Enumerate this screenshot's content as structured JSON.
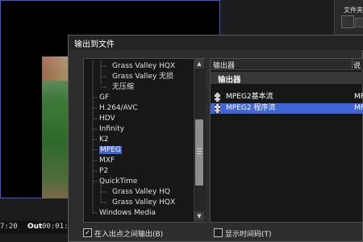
{
  "background": {
    "timecode_in": "7:20",
    "out_label": "Out",
    "timecode_out": "00:01:",
    "right_panel_title": "文件夹"
  },
  "dialog": {
    "title": "输出到文件",
    "tree": {
      "items": [
        {
          "label": "Grass Valley HQX",
          "level": 2
        },
        {
          "label": "Grass Valley 无损",
          "level": 2
        },
        {
          "label": "无压缩",
          "level": 2
        },
        {
          "label": "GF",
          "level": 1
        },
        {
          "label": "H.264/AVC",
          "level": 1
        },
        {
          "label": "HDV",
          "level": 1
        },
        {
          "label": "Infinity",
          "level": 1
        },
        {
          "label": "K2",
          "level": 1
        },
        {
          "label": "MPEG",
          "level": 1,
          "selected": true
        },
        {
          "label": "MXF",
          "level": 1
        },
        {
          "label": "P2",
          "level": 1
        },
        {
          "label": "QuickTime",
          "level": 1
        },
        {
          "label": "Grass Valley HQ",
          "level": 2
        },
        {
          "label": "Grass Valley HQX",
          "level": 2
        },
        {
          "label": "Windows Media",
          "level": 1
        }
      ],
      "scroll_up_icon": "▲",
      "scroll_down_icon": "▼"
    },
    "exporters": {
      "columns": {
        "exporter": "输出器",
        "description": "说明"
      },
      "group_label": "输出器",
      "rows": [
        {
          "name": "MPEG2基本流",
          "desc": "MF",
          "selected": false
        },
        {
          "name": "MPEG2 程序流",
          "desc": "MF",
          "selected": true
        }
      ]
    },
    "options": {
      "export_in_out": {
        "label": "在入出点之间输出(B)",
        "checked": true
      },
      "show_timecode": {
        "label": "显示时间码(T)",
        "checked": false
      }
    }
  },
  "colors": {
    "selection": "#3f65d8",
    "dialog_bg": "#2d2d2d",
    "panel_bg": "#171717"
  }
}
